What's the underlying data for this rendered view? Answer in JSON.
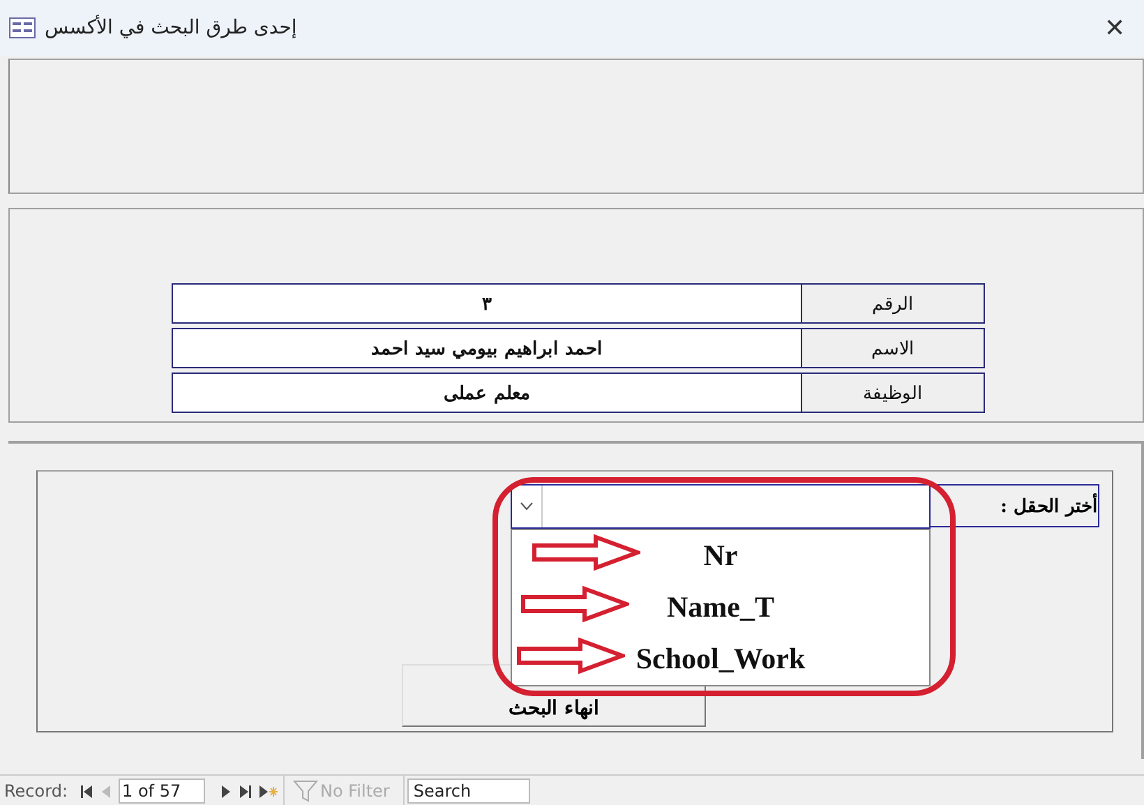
{
  "window": {
    "title": "إحدى طرق البحث في الأكسس",
    "close": "✕"
  },
  "record_table": [
    {
      "label": "الرقم",
      "value": "٣"
    },
    {
      "label": "الاسم",
      "value": "احمد ابراهيم بيومي سيد احمد"
    },
    {
      "label": "الوظيفة",
      "value": "معلم عملى"
    }
  ],
  "field_picker": {
    "label": "أختر الحقل :",
    "expanded": true,
    "options": [
      {
        "label": "Nr"
      },
      {
        "label": "Name_T"
      },
      {
        "label": "School_Work"
      }
    ]
  },
  "end_search_button": {
    "label": "انهاء البحث"
  },
  "status_bar": {
    "record_label": "Record:",
    "position": "1 of 57",
    "filter": "No Filter",
    "filter_disabled": true,
    "search": {
      "placeholder": "Search"
    }
  }
}
